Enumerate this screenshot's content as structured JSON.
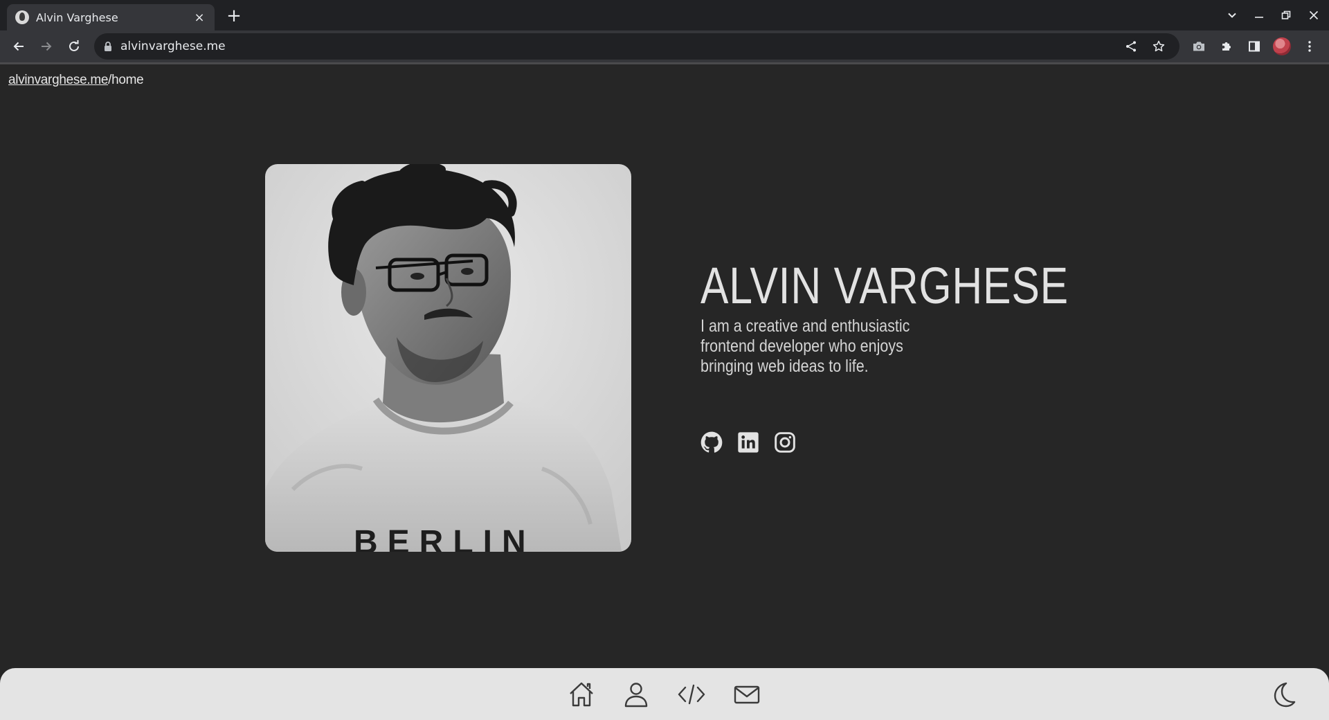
{
  "browser": {
    "tab_title": "Alvin Varghese",
    "tab_close": "×",
    "new_tab": "+",
    "url": "alvinvarghese.me"
  },
  "page": {
    "breadcrumb": {
      "home_link": "alvinvarghese.me",
      "current_path": "/home"
    },
    "hero": {
      "name": "ALVIN VARGHESE",
      "bio": "I am a creative and enthusiastic frontend developer who enjoys bringing web ideas to life."
    },
    "portrait": {
      "shirt_text": "BERLIN"
    },
    "socials": [
      {
        "icon": "github-icon"
      },
      {
        "icon": "linkedin-icon"
      },
      {
        "icon": "instagram-icon"
      }
    ],
    "bottom_nav": [
      {
        "icon": "home-icon"
      },
      {
        "icon": "user-icon"
      },
      {
        "icon": "code-icon"
      },
      {
        "icon": "mail-icon"
      },
      {
        "icon": "moon-icon"
      }
    ]
  },
  "colors": {
    "page_bg": "#262626",
    "text": "#e2e2e2",
    "bottom_nav_bg": "#e4e4e4",
    "chrome_bg": "#202124",
    "toolbar_bg": "#35363a"
  }
}
